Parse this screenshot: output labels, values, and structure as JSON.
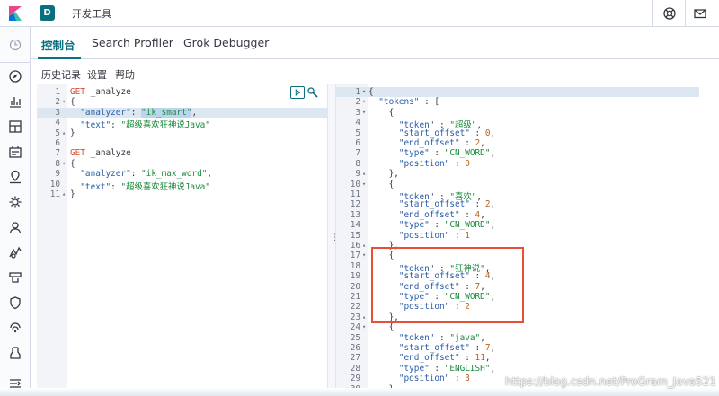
{
  "header": {
    "app_badge": "D",
    "app_title": "开发工具"
  },
  "tabs": [
    {
      "label": "控制台"
    },
    {
      "label": "Search Profiler"
    },
    {
      "label": "Grok Debugger"
    }
  ],
  "menu": [
    {
      "label": "历史记录"
    },
    {
      "label": "设置"
    },
    {
      "label": "帮助"
    }
  ],
  "request_editor": {
    "lines": [
      {
        "no": "1",
        "fold": "",
        "parts": [
          [
            "m-get",
            "GET "
          ],
          [
            "m-path",
            "_analyze"
          ]
        ]
      },
      {
        "no": "2",
        "fold": "▾",
        "parts": [
          [
            "p",
            "{"
          ]
        ]
      },
      {
        "no": "3",
        "fold": "",
        "parts": [
          [
            "k",
            "  \"analyzer\""
          ],
          [
            "p",
            ": "
          ],
          [
            "s",
            "\"ik_smart\""
          ],
          [
            "p",
            ","
          ]
        ]
      },
      {
        "no": "4",
        "fold": "",
        "parts": [
          [
            "k",
            "  \"text\""
          ],
          [
            "p",
            ": "
          ],
          [
            "s",
            "\"超级喜欢狂神说Java\""
          ]
        ]
      },
      {
        "no": "5",
        "fold": "▴",
        "parts": [
          [
            "p",
            "}"
          ]
        ]
      },
      {
        "no": "6",
        "fold": "",
        "parts": []
      },
      {
        "no": "7",
        "fold": "",
        "parts": [
          [
            "m-get",
            "GET "
          ],
          [
            "m-path",
            "_analyze"
          ]
        ]
      },
      {
        "no": "8",
        "fold": "▾",
        "parts": [
          [
            "p",
            "{"
          ]
        ]
      },
      {
        "no": "9",
        "fold": "",
        "parts": [
          [
            "k",
            "  \"analyzer\""
          ],
          [
            "p",
            ": "
          ],
          [
            "s",
            "\"ik_max_word\""
          ],
          [
            "p",
            ","
          ]
        ]
      },
      {
        "no": "10",
        "fold": "",
        "parts": [
          [
            "k",
            "  \"text\""
          ],
          [
            "p",
            ": "
          ],
          [
            "s",
            "\"超级喜欢狂神说Java\""
          ]
        ]
      },
      {
        "no": "11",
        "fold": "▴",
        "parts": [
          [
            "p",
            "}"
          ]
        ]
      }
    ]
  },
  "response_editor": {
    "lines": [
      {
        "no": "1",
        "fold": "▾",
        "parts": [
          [
            "p",
            "{"
          ]
        ]
      },
      {
        "no": "2",
        "fold": "▾",
        "parts": [
          [
            "k",
            "  \"tokens\""
          ],
          [
            "p",
            " : ["
          ]
        ]
      },
      {
        "no": "3",
        "fold": "▾",
        "parts": [
          [
            "p",
            "    {"
          ]
        ]
      },
      {
        "no": "4",
        "fold": "",
        "parts": [
          [
            "k",
            "      \"token\""
          ],
          [
            "p",
            " : "
          ],
          [
            "s",
            "\"超级\""
          ],
          [
            "p",
            ","
          ]
        ]
      },
      {
        "no": "5",
        "fold": "",
        "parts": [
          [
            "k",
            "      \"start_offset\""
          ],
          [
            "p",
            " : "
          ],
          [
            "n",
            "0"
          ],
          [
            "p",
            ","
          ]
        ]
      },
      {
        "no": "6",
        "fold": "",
        "parts": [
          [
            "k",
            "      \"end_offset\""
          ],
          [
            "p",
            " : "
          ],
          [
            "n",
            "2"
          ],
          [
            "p",
            ","
          ]
        ]
      },
      {
        "no": "7",
        "fold": "",
        "parts": [
          [
            "k",
            "      \"type\""
          ],
          [
            "p",
            " : "
          ],
          [
            "s",
            "\"CN_WORD\""
          ],
          [
            "p",
            ","
          ]
        ]
      },
      {
        "no": "8",
        "fold": "",
        "parts": [
          [
            "k",
            "      \"position\""
          ],
          [
            "p",
            " : "
          ],
          [
            "n",
            "0"
          ]
        ]
      },
      {
        "no": "9",
        "fold": "▴",
        "parts": [
          [
            "p",
            "    },"
          ]
        ]
      },
      {
        "no": "10",
        "fold": "▾",
        "parts": [
          [
            "p",
            "    {"
          ]
        ]
      },
      {
        "no": "11",
        "fold": "",
        "parts": [
          [
            "k",
            "      \"token\""
          ],
          [
            "p",
            " : "
          ],
          [
            "s",
            "\"喜欢\""
          ],
          [
            "p",
            ","
          ]
        ]
      },
      {
        "no": "12",
        "fold": "",
        "parts": [
          [
            "k",
            "      \"start_offset\""
          ],
          [
            "p",
            " : "
          ],
          [
            "n",
            "2"
          ],
          [
            "p",
            ","
          ]
        ]
      },
      {
        "no": "13",
        "fold": "",
        "parts": [
          [
            "k",
            "      \"end_offset\""
          ],
          [
            "p",
            " : "
          ],
          [
            "n",
            "4"
          ],
          [
            "p",
            ","
          ]
        ]
      },
      {
        "no": "14",
        "fold": "",
        "parts": [
          [
            "k",
            "      \"type\""
          ],
          [
            "p",
            " : "
          ],
          [
            "s",
            "\"CN_WORD\""
          ],
          [
            "p",
            ","
          ]
        ]
      },
      {
        "no": "15",
        "fold": "",
        "parts": [
          [
            "k",
            "      \"position\""
          ],
          [
            "p",
            " : "
          ],
          [
            "n",
            "1"
          ]
        ]
      },
      {
        "no": "16",
        "fold": "▴",
        "parts": [
          [
            "p",
            "    },"
          ]
        ]
      },
      {
        "no": "17",
        "fold": "▾",
        "parts": [
          [
            "p",
            "    {"
          ]
        ]
      },
      {
        "no": "18",
        "fold": "",
        "parts": [
          [
            "k",
            "      \"token\""
          ],
          [
            "p",
            " : "
          ],
          [
            "s",
            "\"狂神说\""
          ],
          [
            "p",
            ","
          ]
        ]
      },
      {
        "no": "19",
        "fold": "",
        "parts": [
          [
            "k",
            "      \"start_offset\""
          ],
          [
            "p",
            " : "
          ],
          [
            "n",
            "4"
          ],
          [
            "p",
            ","
          ]
        ]
      },
      {
        "no": "20",
        "fold": "",
        "parts": [
          [
            "k",
            "      \"end_offset\""
          ],
          [
            "p",
            " : "
          ],
          [
            "n",
            "7"
          ],
          [
            "p",
            ","
          ]
        ]
      },
      {
        "no": "21",
        "fold": "",
        "parts": [
          [
            "k",
            "      \"type\""
          ],
          [
            "p",
            " : "
          ],
          [
            "s",
            "\"CN_WORD\""
          ],
          [
            "p",
            ","
          ]
        ]
      },
      {
        "no": "22",
        "fold": "",
        "parts": [
          [
            "k",
            "      \"position\""
          ],
          [
            "p",
            " : "
          ],
          [
            "n",
            "2"
          ]
        ]
      },
      {
        "no": "23",
        "fold": "▴",
        "parts": [
          [
            "p",
            "    },"
          ]
        ]
      },
      {
        "no": "24",
        "fold": "▾",
        "parts": [
          [
            "p",
            "    {"
          ]
        ]
      },
      {
        "no": "25",
        "fold": "",
        "parts": [
          [
            "k",
            "      \"token\""
          ],
          [
            "p",
            " : "
          ],
          [
            "s",
            "\"java\""
          ],
          [
            "p",
            ","
          ]
        ]
      },
      {
        "no": "26",
        "fold": "",
        "parts": [
          [
            "k",
            "      \"start_offset\""
          ],
          [
            "p",
            " : "
          ],
          [
            "n",
            "7"
          ],
          [
            "p",
            ","
          ]
        ]
      },
      {
        "no": "27",
        "fold": "",
        "parts": [
          [
            "k",
            "      \"end_offset\""
          ],
          [
            "p",
            " : "
          ],
          [
            "n",
            "11"
          ],
          [
            "p",
            ","
          ]
        ]
      },
      {
        "no": "28",
        "fold": "",
        "parts": [
          [
            "k",
            "      \"type\""
          ],
          [
            "p",
            " : "
          ],
          [
            "s",
            "\"ENGLISH\""
          ],
          [
            "p",
            ","
          ]
        ]
      },
      {
        "no": "29",
        "fold": "",
        "parts": [
          [
            "k",
            "      \"position\""
          ],
          [
            "p",
            " : "
          ],
          [
            "n",
            "3"
          ]
        ]
      },
      {
        "no": "30",
        "fold": "▴",
        "parts": [
          [
            "p",
            "    }"
          ]
        ]
      }
    ]
  },
  "watermark": "https://blog.csdn.net/ProGram_Java521",
  "colors": {
    "accent": "#0a6f7e",
    "highlight_box": "#e4503a"
  },
  "icons": {
    "header": [
      "help-icon",
      "mail-icon"
    ],
    "nav": [
      "clock-icon",
      "compass-icon",
      "chart-icon",
      "dashboard-icon",
      "canvas-icon",
      "maps-icon",
      "ml-icon",
      "user-icon",
      "apm-icon",
      "uptime-icon",
      "siem-icon",
      "monitoring-icon",
      "devtools-icon",
      "collapse-icon"
    ]
  }
}
